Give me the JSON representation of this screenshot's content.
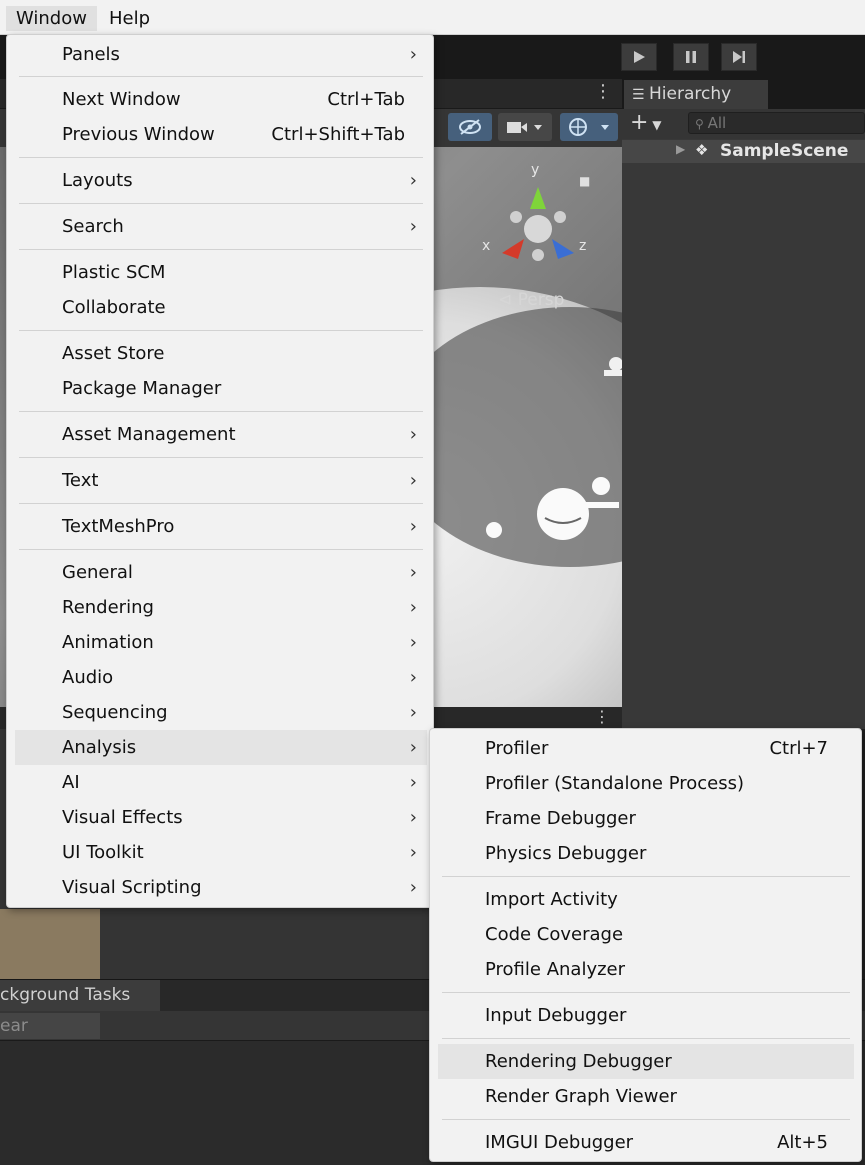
{
  "menubar": {
    "window": "Window",
    "help": "Help"
  },
  "toolbar": {
    "play_icon": "play-icon",
    "pause_icon": "pause-icon",
    "step_icon": "step-icon"
  },
  "scene": {
    "axis_y": "y",
    "axis_x": "x",
    "axis_z": "z",
    "persp": "⊲ Persp"
  },
  "hierarchy": {
    "tab": "Hierarchy",
    "add": "+",
    "search_placeholder": "All",
    "scene_name": "SampleScene"
  },
  "console": {
    "tab": "ckground Tasks",
    "clear": "ear inactive"
  },
  "window_menu": {
    "items": [
      {
        "label": "Panels",
        "shortcut": "",
        "submenu": true
      },
      {
        "label": "Next Window",
        "shortcut": "Ctrl+Tab",
        "submenu": false
      },
      {
        "label": "Previous Window",
        "shortcut": "Ctrl+Shift+Tab",
        "submenu": false
      },
      {
        "label": "Layouts",
        "shortcut": "",
        "submenu": true
      },
      {
        "label": "Search",
        "shortcut": "",
        "submenu": true
      },
      {
        "label": "Plastic SCM",
        "shortcut": "",
        "submenu": false
      },
      {
        "label": "Collaborate",
        "shortcut": "",
        "submenu": false
      },
      {
        "label": "Asset Store",
        "shortcut": "",
        "submenu": false
      },
      {
        "label": "Package Manager",
        "shortcut": "",
        "submenu": false
      },
      {
        "label": "Asset Management",
        "shortcut": "",
        "submenu": true
      },
      {
        "label": "Text",
        "shortcut": "",
        "submenu": true
      },
      {
        "label": "TextMeshPro",
        "shortcut": "",
        "submenu": true
      },
      {
        "label": "General",
        "shortcut": "",
        "submenu": true
      },
      {
        "label": "Rendering",
        "shortcut": "",
        "submenu": true
      },
      {
        "label": "Animation",
        "shortcut": "",
        "submenu": true
      },
      {
        "label": "Audio",
        "shortcut": "",
        "submenu": true
      },
      {
        "label": "Sequencing",
        "shortcut": "",
        "submenu": true
      },
      {
        "label": "Analysis",
        "shortcut": "",
        "submenu": true,
        "highlighted": true
      },
      {
        "label": "AI",
        "shortcut": "",
        "submenu": true
      },
      {
        "label": "Visual Effects",
        "shortcut": "",
        "submenu": true
      },
      {
        "label": "UI Toolkit",
        "shortcut": "",
        "submenu": true
      },
      {
        "label": "Visual Scripting",
        "shortcut": "",
        "submenu": true
      }
    ]
  },
  "analysis_menu": {
    "items": [
      {
        "label": "Profiler",
        "shortcut": "Ctrl+7"
      },
      {
        "label": "Profiler (Standalone Process)",
        "shortcut": ""
      },
      {
        "label": "Frame Debugger",
        "shortcut": ""
      },
      {
        "label": "Physics Debugger",
        "shortcut": ""
      },
      {
        "label": "Import Activity",
        "shortcut": ""
      },
      {
        "label": "Code Coverage",
        "shortcut": ""
      },
      {
        "label": "Profile Analyzer",
        "shortcut": ""
      },
      {
        "label": "Input Debugger",
        "shortcut": ""
      },
      {
        "label": "Rendering Debugger",
        "shortcut": "",
        "highlighted": true
      },
      {
        "label": "Render Graph Viewer",
        "shortcut": ""
      },
      {
        "label": "IMGUI Debugger",
        "shortcut": "Alt+5"
      }
    ]
  }
}
